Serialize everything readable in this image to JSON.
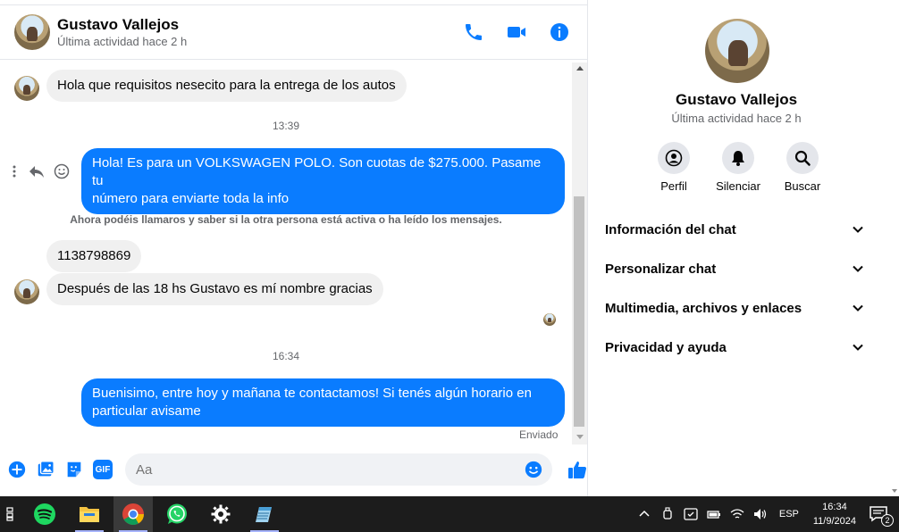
{
  "header": {
    "name": "Gustavo Vallejos",
    "status": "Última actividad hace 2 h",
    "icons": [
      "phone-icon",
      "video-icon",
      "info-icon"
    ]
  },
  "messages": {
    "m1": "Hola que requisitos nesecito para la entrega de los autos",
    "t1": "13:39",
    "m2_line1": "Hola! Es para un VOLKSWAGEN POLO. Son cuotas de $275.000. Pasame tu",
    "m2_line2": "número para enviarte toda la info",
    "system_note": "Ahora podéis llamaros y saber si la otra persona está activa o ha leído los mensajes.",
    "m3": "1138798869",
    "m4": "Después de las 18 hs Gustavo es mí nombre gracias",
    "t2": "16:34",
    "m5_line1": "Buenisimo, entre hoy y mañana te contactamos! Si tenés algún horario en",
    "m5_line2": "particular avisame",
    "delivered": "Enviado"
  },
  "composer": {
    "placeholder": "Aa",
    "icons": [
      "plus-icon",
      "image-icon",
      "sticker-icon",
      "gif-icon",
      "emoji-icon",
      "thumbs-up-icon"
    ],
    "gif_label": "GIF"
  },
  "panel": {
    "name": "Gustavo Vallejos",
    "status": "Última actividad hace 2 h",
    "actions": [
      {
        "label": "Perfil",
        "icon": "profile-icon"
      },
      {
        "label": "Silenciar",
        "icon": "bell-icon"
      },
      {
        "label": "Buscar",
        "icon": "search-icon"
      }
    ],
    "sections": [
      "Información del chat",
      "Personalizar chat",
      "Multimedia, archivos y enlaces",
      "Privacidad y ayuda"
    ]
  },
  "taskbar": {
    "apps": [
      "task-view-icon",
      "spotify-icon",
      "file-explorer-icon",
      "chrome-icon",
      "whatsapp-icon",
      "settings-icon",
      "notepad-icon"
    ],
    "language": "ESP",
    "time": "16:34",
    "date": "11/9/2024",
    "notification_count": "2"
  },
  "colors": {
    "accent": "#0a7cff",
    "incoming_bubble": "#f0f0f0",
    "taskbar": "#1c1c1c"
  }
}
